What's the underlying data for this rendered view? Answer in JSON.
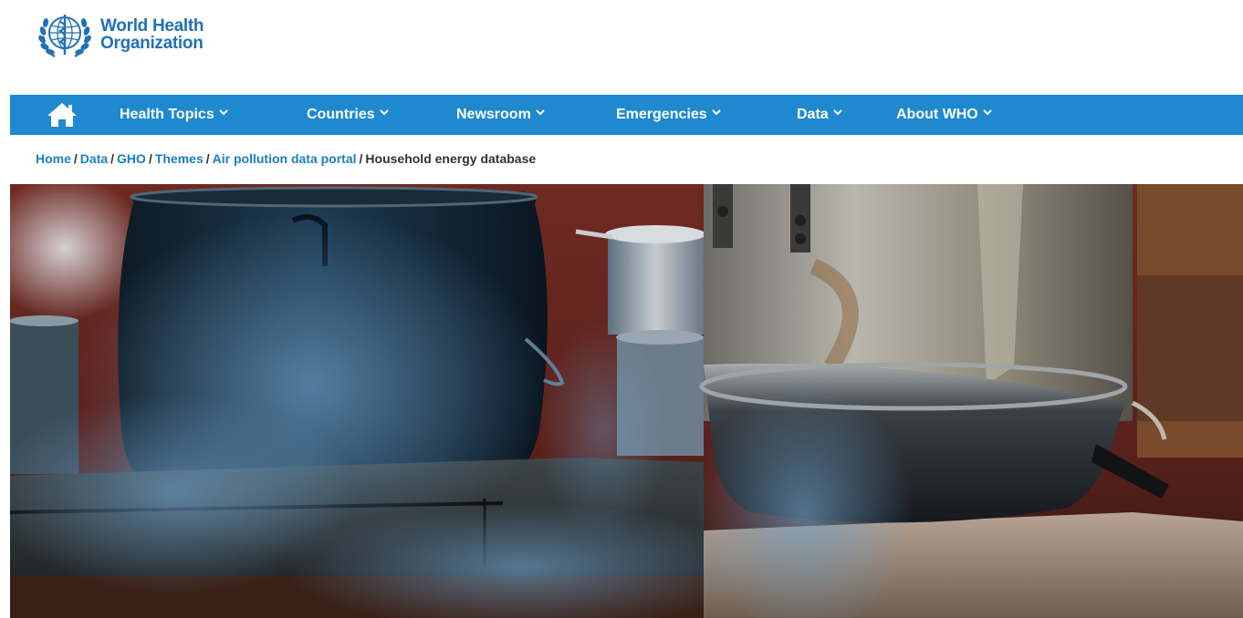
{
  "brand": {
    "name_line1": "World Health",
    "name_line2": "Organization",
    "logo_icon": "who-emblem-icon",
    "brand_color": "#2271b5"
  },
  "nav": {
    "background": "#1f89cf",
    "home_icon": "home-icon",
    "items": [
      {
        "label": "Health Topics"
      },
      {
        "label": "Countries"
      },
      {
        "label": "Newsroom"
      },
      {
        "label": "Emergencies"
      },
      {
        "label": "Data"
      },
      {
        "label": "About WHO"
      }
    ]
  },
  "breadcrumb": {
    "links": [
      "Home",
      "Data",
      "GHO",
      "Themes",
      "Air pollution data portal"
    ],
    "current": "Household energy database",
    "separator": "/"
  },
  "hero": {
    "subject": "cooking pots on a stove with smoke"
  }
}
